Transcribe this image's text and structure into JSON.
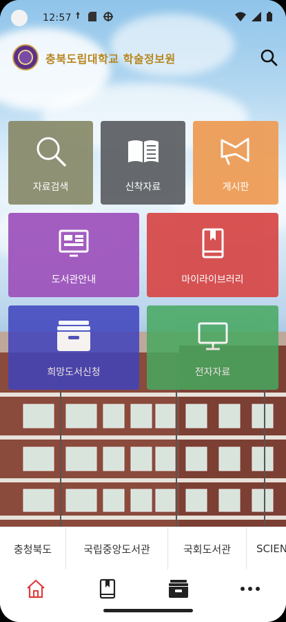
{
  "status": {
    "time": "12:57"
  },
  "header": {
    "title": "충북도립대학교 학술정보원"
  },
  "tiles": [
    {
      "label": "자료검색",
      "icon": "search-icon",
      "color": "#8a8c6c"
    },
    {
      "label": "신착자료",
      "icon": "open-book-icon",
      "color": "#5f6266"
    },
    {
      "label": "게시판",
      "icon": "megaphone-icon",
      "color": "#ee9d57"
    },
    {
      "label": "도서관안내",
      "icon": "monitor-info-icon",
      "color": "#9f55bd"
    },
    {
      "label": "마이라이브러리",
      "icon": "bookmark-book-icon",
      "color": "#d74a4a"
    },
    {
      "label": "희망도서신청",
      "icon": "archive-drawer-icon",
      "color": "#3f43bd"
    },
    {
      "label": "전자자료",
      "icon": "desktop-icon",
      "color": "#47a85f"
    }
  ],
  "quicklinks": [
    "충청북도",
    "국립중앙도서관",
    "국회도서관",
    "SCIENCE"
  ],
  "bottom_nav": [
    {
      "name": "home",
      "icon": "home-icon"
    },
    {
      "name": "book",
      "icon": "book-icon"
    },
    {
      "name": "archive",
      "icon": "archive-icon"
    },
    {
      "name": "more",
      "icon": "more-icon"
    }
  ]
}
